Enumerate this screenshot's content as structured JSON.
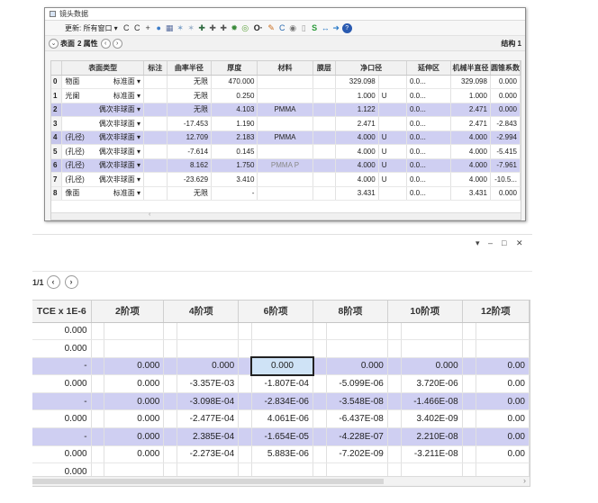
{
  "window1": {
    "title": "镜头数据",
    "toolbar": {
      "update_label": "更新: 所有窗口 ▾",
      "tools": [
        "C",
        "C",
        "+",
        "●",
        "▦",
        "✶",
        "✶",
        "✚",
        "✚",
        "✚",
        "✹",
        "◎",
        "O·",
        "✎",
        "C",
        "◉",
        "▯",
        "S",
        "↔",
        "➜",
        "?"
      ]
    },
    "subbar": {
      "surface_label": "表面",
      "attr_label": "2 属性",
      "structure_label": "结构 1"
    },
    "columns": [
      "表面类型",
      "标注",
      "曲率半径",
      "厚度",
      "材料",
      "膜层",
      "净口径",
      "延伸区",
      "机械半直径",
      "圆锥系数"
    ],
    "rows": [
      {
        "num": "0",
        "name": "物面",
        "type": "标准面 ▾",
        "note": "",
        "radius": "无限",
        "thick": "470.000",
        "material": "",
        "coat": "",
        "clear": "329.098",
        "clear_flag": "",
        "ext": "0.0...",
        "mech": "329.098",
        "conic": "0.000",
        "hl": false
      },
      {
        "num": "1",
        "name": "光阑",
        "type": "标准面 ▾",
        "note": "",
        "radius": "无限",
        "thick": "0.250",
        "material": "",
        "coat": "",
        "clear": "1.000",
        "clear_flag": "U",
        "ext": "0.0...",
        "mech": "1.000",
        "conic": "0.000",
        "hl": false
      },
      {
        "num": "2",
        "name": "",
        "type": "偶次非球面 ▾",
        "note": "",
        "radius": "无限",
        "thick": "4.103",
        "material": "PMMA",
        "coat": "",
        "clear": "1.122",
        "clear_flag": "",
        "ext": "0.0...",
        "mech": "2.471",
        "conic": "0.000",
        "hl": true
      },
      {
        "num": "3",
        "name": "",
        "type": "偶次非球面 ▾",
        "note": "",
        "radius": "-17.453",
        "thick": "1.190",
        "material": "",
        "coat": "",
        "clear": "2.471",
        "clear_flag": "",
        "ext": "0.0...",
        "mech": "2.471",
        "conic": "-2.843",
        "hl": false
      },
      {
        "num": "4",
        "name": "(孔径)",
        "type": "偶次非球面 ▾",
        "note": "",
        "radius": "12.709",
        "thick": "2.183",
        "material": "PMMA",
        "coat": "",
        "clear": "4.000",
        "clear_flag": "U",
        "ext": "0.0...",
        "mech": "4.000",
        "conic": "-2.994",
        "hl": true
      },
      {
        "num": "5",
        "name": "(孔径)",
        "type": "偶次非球面 ▾",
        "note": "",
        "radius": "-7.614",
        "thick": "0.145",
        "material": "",
        "coat": "",
        "clear": "4.000",
        "clear_flag": "U",
        "ext": "0.0...",
        "mech": "4.000",
        "conic": "-5.415",
        "hl": false
      },
      {
        "num": "6",
        "name": "(孔径)",
        "type": "偶次非球面 ▾",
        "note": "",
        "radius": "8.162",
        "thick": "1.750",
        "material": "PMMA  P",
        "coat": "",
        "clear": "4.000",
        "clear_flag": "U",
        "ext": "0.0...",
        "mech": "4.000",
        "conic": "-7.961",
        "hl": true
      },
      {
        "num": "7",
        "name": "(孔径)",
        "type": "偶次非球面 ▾",
        "note": "",
        "radius": "-23.629",
        "thick": "3.410",
        "material": "",
        "coat": "",
        "clear": "4.000",
        "clear_flag": "U",
        "ext": "0.0...",
        "mech": "4.000",
        "conic": "-10.5...",
        "hl": false
      },
      {
        "num": "8",
        "name": "像面",
        "type": "标准面 ▾",
        "note": "",
        "radius": "无限",
        "thick": "-",
        "material": "",
        "coat": "",
        "clear": "3.431",
        "clear_flag": "",
        "ext": "0.0...",
        "mech": "3.431",
        "conic": "0.000",
        "hl": false
      }
    ]
  },
  "window2": {
    "controls": {
      "dropdown": "▾",
      "minimize": "–",
      "maximize": "□",
      "close": "✕"
    },
    "pager_label": "1/1",
    "columns": [
      "TCE x 1E-6",
      "2阶项",
      "4阶项",
      "6阶项",
      "8阶项",
      "10阶项",
      "12阶项"
    ],
    "rows": [
      {
        "tce": "0.000",
        "c2": "",
        "c4": "",
        "c6": "",
        "c8": "",
        "c10": "",
        "c12": "",
        "hl": false
      },
      {
        "tce": "0.000",
        "c2": "",
        "c4": "",
        "c6": "",
        "c8": "",
        "c10": "",
        "c12": "",
        "hl": false
      },
      {
        "tce": "-",
        "c2": "0.000",
        "c4": "0.000",
        "c6": "0.000",
        "c8": "0.000",
        "c10": "0.000",
        "c12": "0.00",
        "hl": true
      },
      {
        "tce": "0.000",
        "c2": "0.000",
        "c4": "-3.357E-03",
        "c6": "-1.807E-04",
        "c8": "-5.099E-06",
        "c10": "3.720E-06",
        "c12": "0.00",
        "hl": false
      },
      {
        "tce": "-",
        "c2": "0.000",
        "c4": "-3.098E-04",
        "c6": "-2.834E-06",
        "c8": "-3.548E-08",
        "c10": "-1.466E-08",
        "c12": "0.00",
        "hl": true
      },
      {
        "tce": "0.000",
        "c2": "0.000",
        "c4": "-2.477E-04",
        "c6": "4.061E-06",
        "c8": "-6.437E-08",
        "c10": "3.402E-09",
        "c12": "0.00",
        "hl": false
      },
      {
        "tce": "-",
        "c2": "0.000",
        "c4": "2.385E-04",
        "c6": "-1.654E-05",
        "c8": "-4.228E-07",
        "c10": "2.210E-08",
        "c12": "0.00",
        "hl": true
      },
      {
        "tce": "0.000",
        "c2": "0.000",
        "c4": "-2.273E-04",
        "c6": "5.883E-06",
        "c8": "-7.202E-09",
        "c10": "-3.211E-08",
        "c12": "0.00",
        "hl": false
      },
      {
        "tce": "0.000",
        "c2": "",
        "c4": "",
        "c6": "",
        "c8": "",
        "c10": "",
        "c12": "",
        "hl": false
      }
    ]
  }
}
